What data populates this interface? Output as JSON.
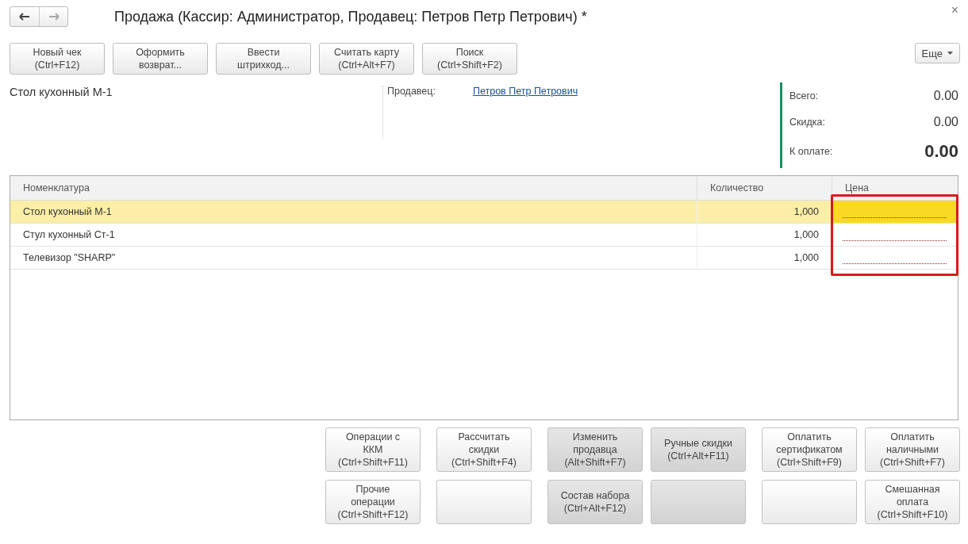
{
  "window": {
    "title": "Продажа (Кассир: Администратор, Продавец: Петров Петр Петрович) *",
    "close": "×"
  },
  "toolbar": {
    "buttons": [
      {
        "line1": "Новый чек",
        "line2": "(Ctrl+F12)"
      },
      {
        "line1": "Оформить",
        "line2": "возврат..."
      },
      {
        "line1": "Ввести",
        "line2": "штрихкод..."
      },
      {
        "line1": "Считать карту",
        "line2": "(Ctrl+Alt+F7)"
      },
      {
        "line1": "Поиск",
        "line2": "(Ctrl+Shift+F2)"
      }
    ],
    "more": "Еще"
  },
  "current_item": "Стол кухонный М-1",
  "seller": {
    "label": "Продавец:",
    "value": "Петров Петр Петрович"
  },
  "totals": [
    {
      "label": "Всего:",
      "value": "0.00",
      "emphasis": false
    },
    {
      "label": "Скидка:",
      "value": "0.00",
      "emphasis": false
    },
    {
      "label": "К оплате:",
      "value": "0.00",
      "emphasis": true
    }
  ],
  "table": {
    "columns": [
      "Номенклатура",
      "Количество",
      "Цена"
    ],
    "price_column_highlighted": true,
    "rows": [
      {
        "name": "Стол кухонный М-1",
        "quantity": "1,000",
        "selected": true
      },
      {
        "name": "Стул кухонный Ст-1",
        "quantity": "1,000",
        "selected": false
      },
      {
        "name": "Телевизор \"SHARP\"",
        "quantity": "1,000",
        "selected": false
      }
    ]
  },
  "actions": [
    [
      {
        "kind": "normal",
        "lines": [
          "Операции с",
          "ККМ",
          "(Ctrl+Shift+F11)"
        ]
      },
      {
        "kind": "normal",
        "lines": [
          "Рассчитать",
          "скидки",
          "(Ctrl+Shift+F4)"
        ]
      },
      {
        "kind": "shaded",
        "lines": [
          "Изменить",
          "продавца",
          "(Alt+Shift+F7)"
        ]
      },
      {
        "kind": "shaded",
        "lines": [
          "Ручные скидки",
          "(Ctrl+Alt+F11)"
        ]
      },
      {
        "kind": "normal",
        "lines": [
          "Оплатить",
          "сертификатом",
          "(Ctrl+Shift+F9)"
        ]
      },
      {
        "kind": "normal",
        "lines": [
          "Оплатить",
          "наличными",
          "(Ctrl+Shift+F7)"
        ]
      }
    ],
    [
      {
        "kind": "normal",
        "lines": [
          "Прочие",
          "операции",
          "(Ctrl+Shift+F12)"
        ]
      },
      {
        "kind": "blank"
      },
      {
        "kind": "shaded",
        "lines": [
          "Состав набора",
          "(Ctrl+Alt+F12)"
        ]
      },
      {
        "kind": "blank-shaded"
      },
      {
        "kind": "blank"
      },
      {
        "kind": "normal",
        "lines": [
          "Смешанная",
          "оплата",
          "(Ctrl+Shift+F10)"
        ]
      }
    ]
  ]
}
